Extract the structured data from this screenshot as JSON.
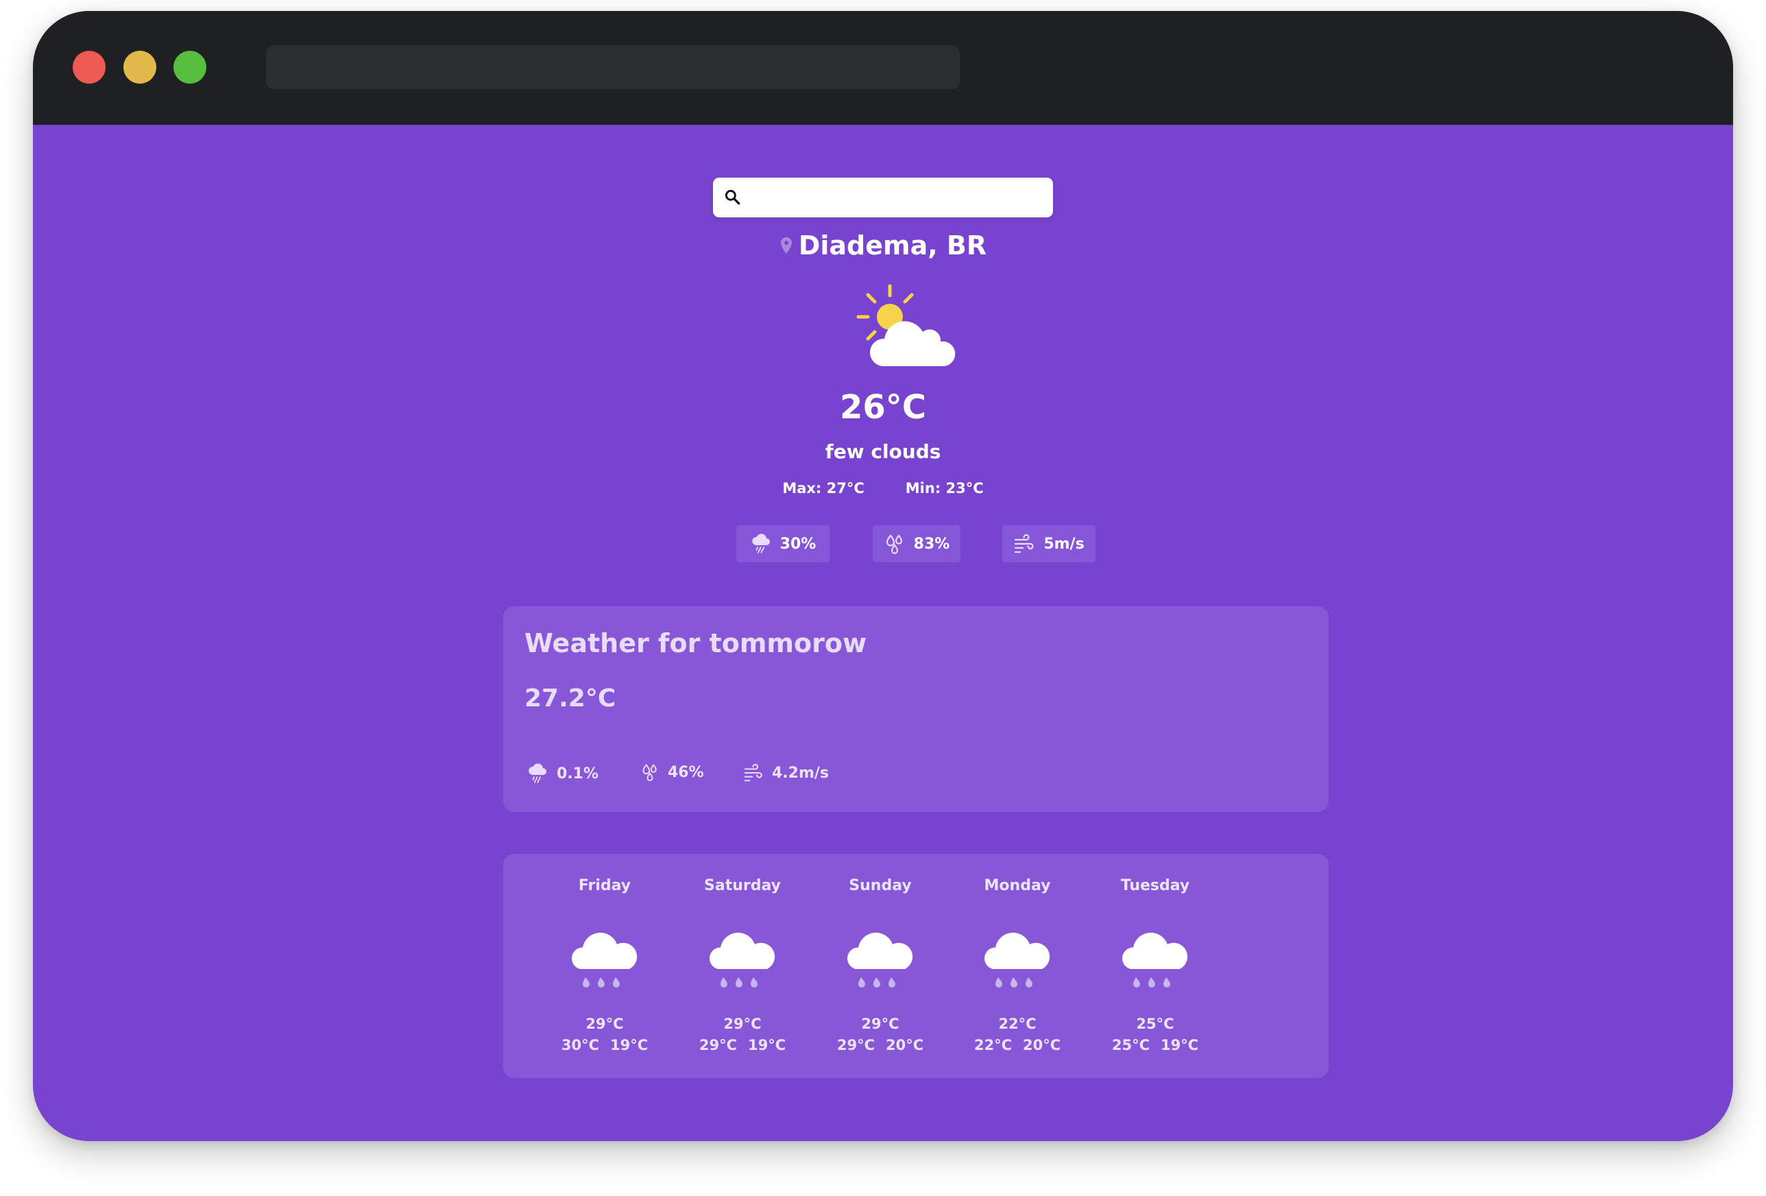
{
  "search": {
    "value": "",
    "placeholder": ""
  },
  "location": {
    "city": "Diadema, BR"
  },
  "current": {
    "temperature": "26°C",
    "description": "few clouds",
    "max": "Max: 27°C",
    "min": "Min: 23°C",
    "rain": "30%",
    "humidity": "83%",
    "wind": "5m/s",
    "icon": "partly-cloudy-sun-icon"
  },
  "tomorrow": {
    "title": "Weather for tommorow",
    "temperature": "27.2°C",
    "rain": "0.1%",
    "humidity": "46%",
    "wind": "4.2m/s"
  },
  "forecast": [
    {
      "day": "Friday",
      "temp": "29°C",
      "max": "30°C",
      "min": "19°C",
      "icon": "rain-cloud-icon"
    },
    {
      "day": "Saturday",
      "temp": "29°C",
      "max": "29°C",
      "min": "19°C",
      "icon": "rain-cloud-icon"
    },
    {
      "day": "Sunday",
      "temp": "29°C",
      "max": "29°C",
      "min": "20°C",
      "icon": "rain-cloud-icon"
    },
    {
      "day": "Monday",
      "temp": "22°C",
      "max": "22°C",
      "min": "20°C",
      "icon": "rain-cloud-icon"
    },
    {
      "day": "Tuesday",
      "temp": "25°C",
      "max": "25°C",
      "min": "19°C",
      "icon": "rain-cloud-icon"
    }
  ],
  "colors": {
    "background": "#7843cf",
    "card": "#8757d8",
    "sun": "#f7d34b",
    "titlebar": "#1f2022"
  }
}
